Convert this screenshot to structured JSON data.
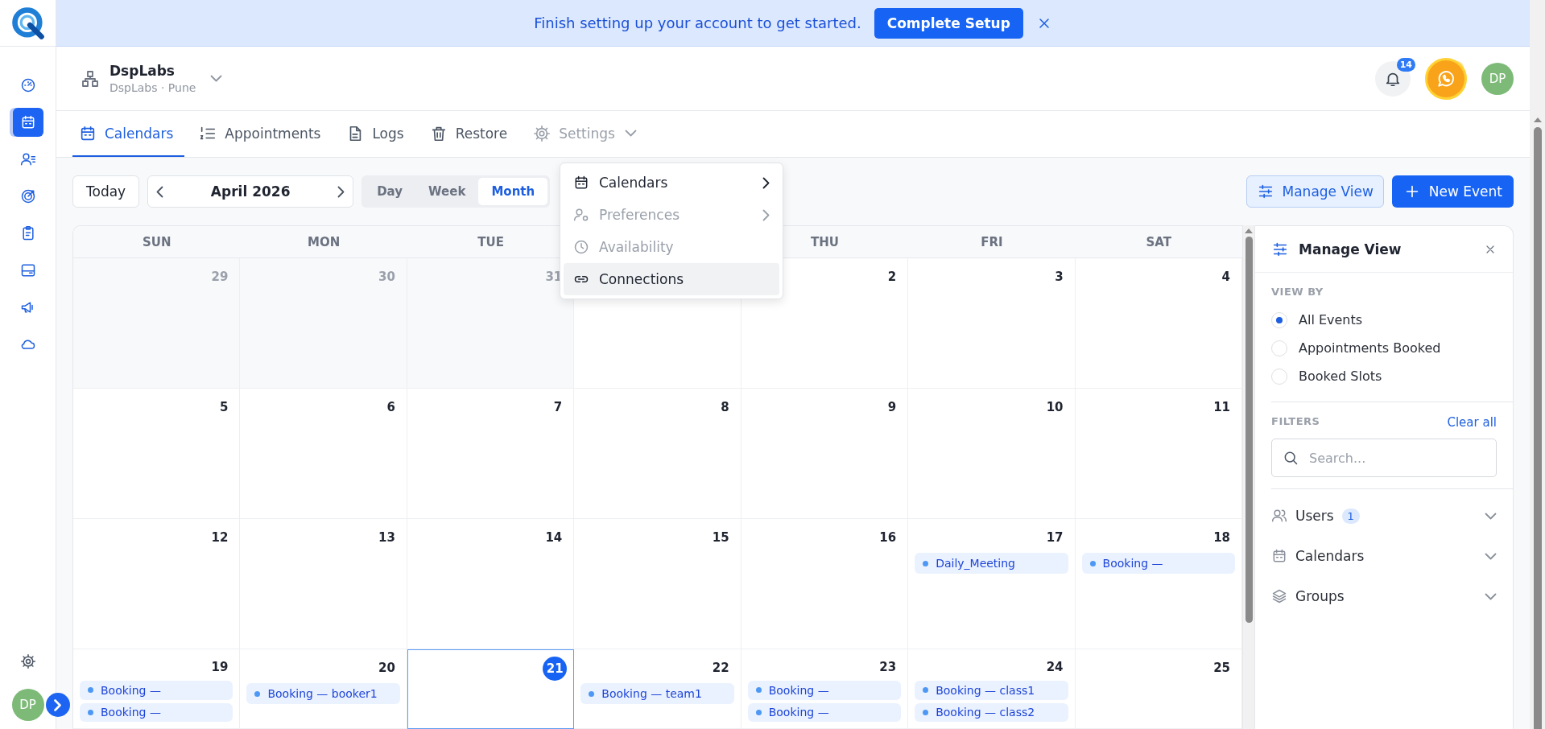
{
  "banner": {
    "message": "Finish setting up your account to get started.",
    "action": "Complete Setup"
  },
  "sidebar": {
    "items": [
      {
        "kind": "gauge",
        "selected": false
      },
      {
        "kind": "calendar",
        "selected": true
      },
      {
        "kind": "contacts",
        "selected": false
      },
      {
        "kind": "target",
        "selected": false
      },
      {
        "kind": "clipboard",
        "selected": false
      },
      {
        "kind": "card",
        "selected": false
      },
      {
        "kind": "megaphone",
        "selected": false
      },
      {
        "kind": "cloud",
        "selected": false
      }
    ],
    "avatar": "DP"
  },
  "header": {
    "org_name": "DspLabs",
    "org_location": "DspLabs · Pune",
    "notification_count": "14",
    "avatar": "DP"
  },
  "tabs": [
    {
      "label": "Calendars",
      "kind": "calendar",
      "selected": true,
      "expanded": false
    },
    {
      "label": "Appointments",
      "kind": "numlist",
      "selected": false,
      "expanded": false
    },
    {
      "label": "Logs",
      "kind": "file",
      "selected": false,
      "expanded": false
    },
    {
      "label": "Restore",
      "kind": "trash",
      "selected": false,
      "expanded": false
    },
    {
      "label": "Settings",
      "kind": "gear",
      "selected": false,
      "expanded": true
    }
  ],
  "settings_menu": [
    {
      "label": "Calendars",
      "kind": "calendar",
      "disabled": false,
      "highlighted": false,
      "submenu": true
    },
    {
      "label": "Preferences",
      "kind": "usergear",
      "disabled": true,
      "highlighted": false,
      "submenu": true
    },
    {
      "label": "Availability",
      "kind": "clock",
      "disabled": true,
      "highlighted": false,
      "submenu": false
    },
    {
      "label": "Connections",
      "kind": "link",
      "disabled": false,
      "highlighted": true,
      "submenu": false
    }
  ],
  "toolbar": {
    "today": "Today",
    "period": "April 2026",
    "views": [
      {
        "label": "Day",
        "selected": false
      },
      {
        "label": "Week",
        "selected": false
      },
      {
        "label": "Month",
        "selected": true
      }
    ],
    "manage_view": "Manage View",
    "new_event": "New Event"
  },
  "calendar": {
    "weekdays": [
      {
        "kind": "label",
        "label": "SUN"
      },
      {
        "kind": "label",
        "label": "MON"
      },
      {
        "kind": "label",
        "label": "TUE"
      },
      {
        "kind": "covered"
      },
      {
        "kind": "label",
        "label": "THU"
      },
      {
        "kind": "label",
        "label": "FRI"
      },
      {
        "kind": "label",
        "label": "SAT"
      }
    ],
    "weeks": [
      [
        {
          "date": "29",
          "outside": true,
          "today": false
        },
        {
          "date": "30",
          "outside": true,
          "today": false
        },
        {
          "date": "31",
          "outside": true,
          "today": false
        },
        {
          "kind": "covered"
        },
        {
          "date": "2",
          "outside": false,
          "today": false
        },
        {
          "date": "3",
          "outside": false,
          "today": false
        },
        {
          "date": "4",
          "outside": false,
          "today": false
        }
      ],
      [
        {
          "date": "5",
          "outside": false,
          "today": false
        },
        {
          "date": "6",
          "outside": false,
          "today": false
        },
        {
          "date": "7",
          "outside": false,
          "today": false
        },
        {
          "date": "8",
          "outside": false,
          "today": false
        },
        {
          "date": "9",
          "outside": false,
          "today": false
        },
        {
          "date": "10",
          "outside": false,
          "today": false
        },
        {
          "date": "11",
          "outside": false,
          "today": false
        }
      ],
      [
        {
          "date": "12",
          "outside": false,
          "today": false
        },
        {
          "date": "13",
          "outside": false,
          "today": false
        },
        {
          "date": "14",
          "outside": false,
          "today": false
        },
        {
          "date": "15",
          "outside": false,
          "today": false
        },
        {
          "date": "16",
          "outside": false,
          "today": false
        },
        {
          "date": "17",
          "outside": false,
          "today": false,
          "events": [
            "Daily_Meeting"
          ]
        },
        {
          "date": "18",
          "outside": false,
          "today": false,
          "events": [
            "Booking —"
          ]
        }
      ],
      [
        {
          "date": "19",
          "outside": false,
          "today": false,
          "events": [
            "Booking —",
            "Booking —"
          ]
        },
        {
          "date": "20",
          "outside": false,
          "today": false,
          "events": [
            "Booking — booker1"
          ]
        },
        {
          "date": "21",
          "outside": false,
          "today": true
        },
        {
          "date": "22",
          "outside": false,
          "today": false,
          "events": [
            "Booking — team1"
          ]
        },
        {
          "date": "23",
          "outside": false,
          "today": false,
          "events": [
            "Booking —",
            "Booking —"
          ]
        },
        {
          "date": "24",
          "outside": false,
          "today": false,
          "events": [
            "Booking — class1",
            "Booking — class2"
          ]
        },
        {
          "date": "25",
          "outside": false,
          "today": false
        }
      ]
    ]
  },
  "manage_panel": {
    "title": "Manage View",
    "view_by_label": "VIEW BY",
    "view_options": [
      {
        "label": "All Events",
        "selected": true
      },
      {
        "label": "Appointments Booked",
        "selected": false
      },
      {
        "label": "Booked Slots",
        "selected": false
      }
    ],
    "filters_label": "FILTERS",
    "clear_all": "Clear all",
    "search_placeholder": "Search...",
    "filters": [
      {
        "label": "Users",
        "kind": "users",
        "count": "1"
      },
      {
        "label": "Calendars",
        "kind": "calendar"
      },
      {
        "label": "Groups",
        "kind": "layers"
      }
    ]
  }
}
